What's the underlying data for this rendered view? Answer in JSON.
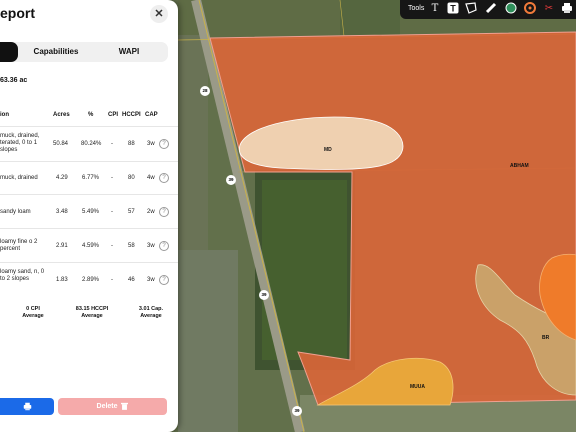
{
  "report": {
    "title": "eport",
    "close_icon": "✕",
    "tabs": [
      {
        "label": ""
      },
      {
        "label": "Capabilities"
      },
      {
        "label": "WAPI"
      }
    ],
    "total_acreage": "63.36 ac",
    "columns": {
      "description": "ion",
      "acres": "Acres",
      "percent": "%",
      "cpi": "CPI",
      "hccpi": "HCCPI",
      "cap": "CAP"
    },
    "rows": [
      {
        "desc": "muck, drained, terated, 0 to 1 slopes",
        "acres": "50.84",
        "percent": "80.24%",
        "cpi": "-",
        "hccpi": "88",
        "cap": "3w"
      },
      {
        "desc": "muck, drained",
        "acres": "4.29",
        "percent": "6.77%",
        "cpi": "-",
        "hccpi": "80",
        "cap": "4w"
      },
      {
        "desc": "sandy loam",
        "acres": "3.48",
        "percent": "5.49%",
        "cpi": "-",
        "hccpi": "57",
        "cap": "2w"
      },
      {
        "desc": "loamy fine o 2 percent",
        "acres": "2.91",
        "percent": "4.59%",
        "cpi": "-",
        "hccpi": "58",
        "cap": "3w"
      },
      {
        "desc": "loamy sand, n, 0 to 2 slopes",
        "acres": "1.83",
        "percent": "2.89%",
        "cpi": "-",
        "hccpi": "46",
        "cap": "3w"
      }
    ],
    "averages": {
      "cpi": "0 CPI",
      "cpi_sub": "Average",
      "hccpi": "83.15 HCCPI",
      "hccpi_sub": "Average",
      "cap": "3.01 Cap.",
      "cap_sub": "Average"
    },
    "print_icon": "print-icon",
    "delete_label": "Delete"
  },
  "toolbar": {
    "label": "Tools",
    "tools": [
      "text-icon",
      "text-box-icon",
      "polygon-icon",
      "ruler-icon",
      "globe-icon",
      "target-icon",
      "scissors-icon",
      "print-icon"
    ]
  },
  "map": {
    "soil_labels": [
      "MD",
      "ABHAM",
      "BR",
      "MUUA"
    ],
    "road_shields": [
      "28",
      "39",
      "39",
      "39"
    ],
    "colors": {
      "soil_main": "#d86638",
      "soil_md": "#f0d6b6",
      "soil_br": "#c9a46b",
      "soil_muua": "#e8a63a",
      "soil_bright": "#ef7b2a"
    }
  }
}
